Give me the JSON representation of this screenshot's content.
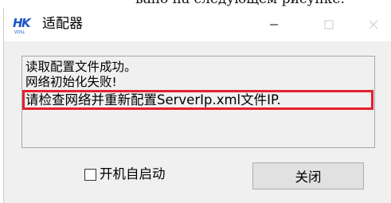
{
  "top_strip": {
    "text": "вано на следующем рисунке."
  },
  "window": {
    "title": "适配器",
    "logo_lettering": "HK VDSL",
    "controls": {
      "minimize_icon": "minimize-icon",
      "maximize_icon": "maximize-icon",
      "close_icon": "close-icon"
    }
  },
  "messages": {
    "line1": "读取配置文件成功。",
    "line2": "网络初始化失败!",
    "line3": "请检查网络并重新配置ServerIp.xml文件IP."
  },
  "autostart": {
    "label": "开机自启动",
    "checked": false
  },
  "close_button": {
    "label": "关闭"
  },
  "colors": {
    "highlight_frame": "#e5202e",
    "dialog_background": "#f0f0f0",
    "logo_blue": "#1b55c9"
  }
}
